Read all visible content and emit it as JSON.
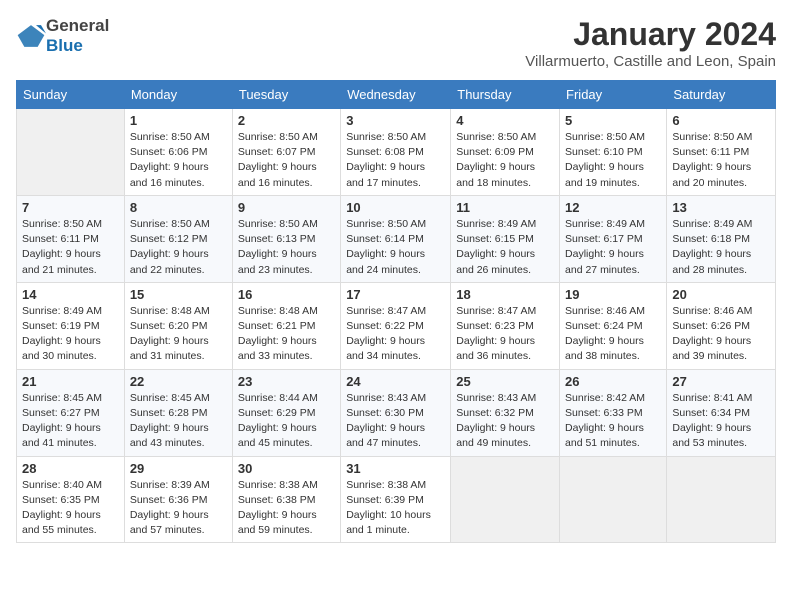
{
  "header": {
    "logo_general": "General",
    "logo_blue": "Blue",
    "month_year": "January 2024",
    "location": "Villarmuerto, Castille and Leon, Spain"
  },
  "weekdays": [
    "Sunday",
    "Monday",
    "Tuesday",
    "Wednesday",
    "Thursday",
    "Friday",
    "Saturday"
  ],
  "weeks": [
    [
      {
        "day": "",
        "info": ""
      },
      {
        "day": "1",
        "info": "Sunrise: 8:50 AM\nSunset: 6:06 PM\nDaylight: 9 hours\nand 16 minutes."
      },
      {
        "day": "2",
        "info": "Sunrise: 8:50 AM\nSunset: 6:07 PM\nDaylight: 9 hours\nand 16 minutes."
      },
      {
        "day": "3",
        "info": "Sunrise: 8:50 AM\nSunset: 6:08 PM\nDaylight: 9 hours\nand 17 minutes."
      },
      {
        "day": "4",
        "info": "Sunrise: 8:50 AM\nSunset: 6:09 PM\nDaylight: 9 hours\nand 18 minutes."
      },
      {
        "day": "5",
        "info": "Sunrise: 8:50 AM\nSunset: 6:10 PM\nDaylight: 9 hours\nand 19 minutes."
      },
      {
        "day": "6",
        "info": "Sunrise: 8:50 AM\nSunset: 6:11 PM\nDaylight: 9 hours\nand 20 minutes."
      }
    ],
    [
      {
        "day": "7",
        "info": "Sunrise: 8:50 AM\nSunset: 6:11 PM\nDaylight: 9 hours\nand 21 minutes."
      },
      {
        "day": "8",
        "info": "Sunrise: 8:50 AM\nSunset: 6:12 PM\nDaylight: 9 hours\nand 22 minutes."
      },
      {
        "day": "9",
        "info": "Sunrise: 8:50 AM\nSunset: 6:13 PM\nDaylight: 9 hours\nand 23 minutes."
      },
      {
        "day": "10",
        "info": "Sunrise: 8:50 AM\nSunset: 6:14 PM\nDaylight: 9 hours\nand 24 minutes."
      },
      {
        "day": "11",
        "info": "Sunrise: 8:49 AM\nSunset: 6:15 PM\nDaylight: 9 hours\nand 26 minutes."
      },
      {
        "day": "12",
        "info": "Sunrise: 8:49 AM\nSunset: 6:17 PM\nDaylight: 9 hours\nand 27 minutes."
      },
      {
        "day": "13",
        "info": "Sunrise: 8:49 AM\nSunset: 6:18 PM\nDaylight: 9 hours\nand 28 minutes."
      }
    ],
    [
      {
        "day": "14",
        "info": "Sunrise: 8:49 AM\nSunset: 6:19 PM\nDaylight: 9 hours\nand 30 minutes."
      },
      {
        "day": "15",
        "info": "Sunrise: 8:48 AM\nSunset: 6:20 PM\nDaylight: 9 hours\nand 31 minutes."
      },
      {
        "day": "16",
        "info": "Sunrise: 8:48 AM\nSunset: 6:21 PM\nDaylight: 9 hours\nand 33 minutes."
      },
      {
        "day": "17",
        "info": "Sunrise: 8:47 AM\nSunset: 6:22 PM\nDaylight: 9 hours\nand 34 minutes."
      },
      {
        "day": "18",
        "info": "Sunrise: 8:47 AM\nSunset: 6:23 PM\nDaylight: 9 hours\nand 36 minutes."
      },
      {
        "day": "19",
        "info": "Sunrise: 8:46 AM\nSunset: 6:24 PM\nDaylight: 9 hours\nand 38 minutes."
      },
      {
        "day": "20",
        "info": "Sunrise: 8:46 AM\nSunset: 6:26 PM\nDaylight: 9 hours\nand 39 minutes."
      }
    ],
    [
      {
        "day": "21",
        "info": "Sunrise: 8:45 AM\nSunset: 6:27 PM\nDaylight: 9 hours\nand 41 minutes."
      },
      {
        "day": "22",
        "info": "Sunrise: 8:45 AM\nSunset: 6:28 PM\nDaylight: 9 hours\nand 43 minutes."
      },
      {
        "day": "23",
        "info": "Sunrise: 8:44 AM\nSunset: 6:29 PM\nDaylight: 9 hours\nand 45 minutes."
      },
      {
        "day": "24",
        "info": "Sunrise: 8:43 AM\nSunset: 6:30 PM\nDaylight: 9 hours\nand 47 minutes."
      },
      {
        "day": "25",
        "info": "Sunrise: 8:43 AM\nSunset: 6:32 PM\nDaylight: 9 hours\nand 49 minutes."
      },
      {
        "day": "26",
        "info": "Sunrise: 8:42 AM\nSunset: 6:33 PM\nDaylight: 9 hours\nand 51 minutes."
      },
      {
        "day": "27",
        "info": "Sunrise: 8:41 AM\nSunset: 6:34 PM\nDaylight: 9 hours\nand 53 minutes."
      }
    ],
    [
      {
        "day": "28",
        "info": "Sunrise: 8:40 AM\nSunset: 6:35 PM\nDaylight: 9 hours\nand 55 minutes."
      },
      {
        "day": "29",
        "info": "Sunrise: 8:39 AM\nSunset: 6:36 PM\nDaylight: 9 hours\nand 57 minutes."
      },
      {
        "day": "30",
        "info": "Sunrise: 8:38 AM\nSunset: 6:38 PM\nDaylight: 9 hours\nand 59 minutes."
      },
      {
        "day": "31",
        "info": "Sunrise: 8:38 AM\nSunset: 6:39 PM\nDaylight: 10 hours\nand 1 minute."
      },
      {
        "day": "",
        "info": ""
      },
      {
        "day": "",
        "info": ""
      },
      {
        "day": "",
        "info": ""
      }
    ]
  ]
}
